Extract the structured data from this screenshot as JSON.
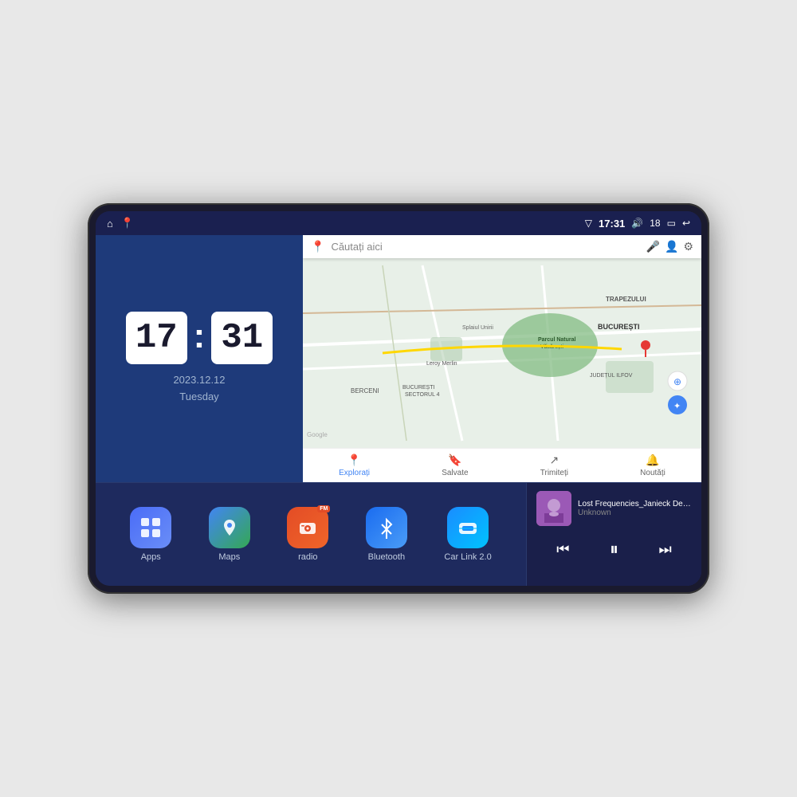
{
  "device": {
    "statusBar": {
      "leftIcons": [
        "home-icon",
        "maps-pin-icon"
      ],
      "time": "17:31",
      "signalIcon": "signal-icon",
      "volumeIcon": "volume-icon",
      "volumeLevel": "18",
      "batteryIcon": "battery-icon",
      "backIcon": "back-icon"
    },
    "clock": {
      "hours": "17",
      "minutes": "31",
      "date": "2023.12.12",
      "dayOfWeek": "Tuesday"
    },
    "map": {
      "searchPlaceholder": "Căutați aici",
      "bottomNav": [
        {
          "label": "Explorați",
          "icon": "explore-icon",
          "active": true
        },
        {
          "label": "Salvate",
          "icon": "bookmark-icon",
          "active": false
        },
        {
          "label": "Trimiteți",
          "icon": "share-icon",
          "active": false
        },
        {
          "label": "Noutăți",
          "icon": "bell-icon",
          "active": false
        }
      ],
      "mapLabels": [
        "TRAPEZULUI",
        "BUCUREȘTI",
        "JUDEȚUL ILFOV",
        "BERCENI",
        "Leroy Merlin",
        "Parcul Natural Văcărești",
        "BUCUREȘTI SECTORUL 4",
        "Splaiul Unirii"
      ]
    },
    "apps": [
      {
        "id": "apps",
        "label": "Apps",
        "iconType": "apps-icon",
        "icon": "⊞"
      },
      {
        "id": "maps",
        "label": "Maps",
        "iconType": "maps-icon",
        "icon": "📍"
      },
      {
        "id": "radio",
        "label": "radio",
        "iconType": "radio-icon",
        "icon": "📻",
        "badge": "FM"
      },
      {
        "id": "bluetooth",
        "label": "Bluetooth",
        "iconType": "bluetooth-icon",
        "icon": ""
      },
      {
        "id": "carlink",
        "label": "Car Link 2.0",
        "iconType": "carlink-icon",
        "icon": "🚗"
      }
    ],
    "musicPlayer": {
      "title": "Lost Frequencies_Janieck Devy-...",
      "artist": "Unknown",
      "thumbnail": "🎵"
    }
  }
}
